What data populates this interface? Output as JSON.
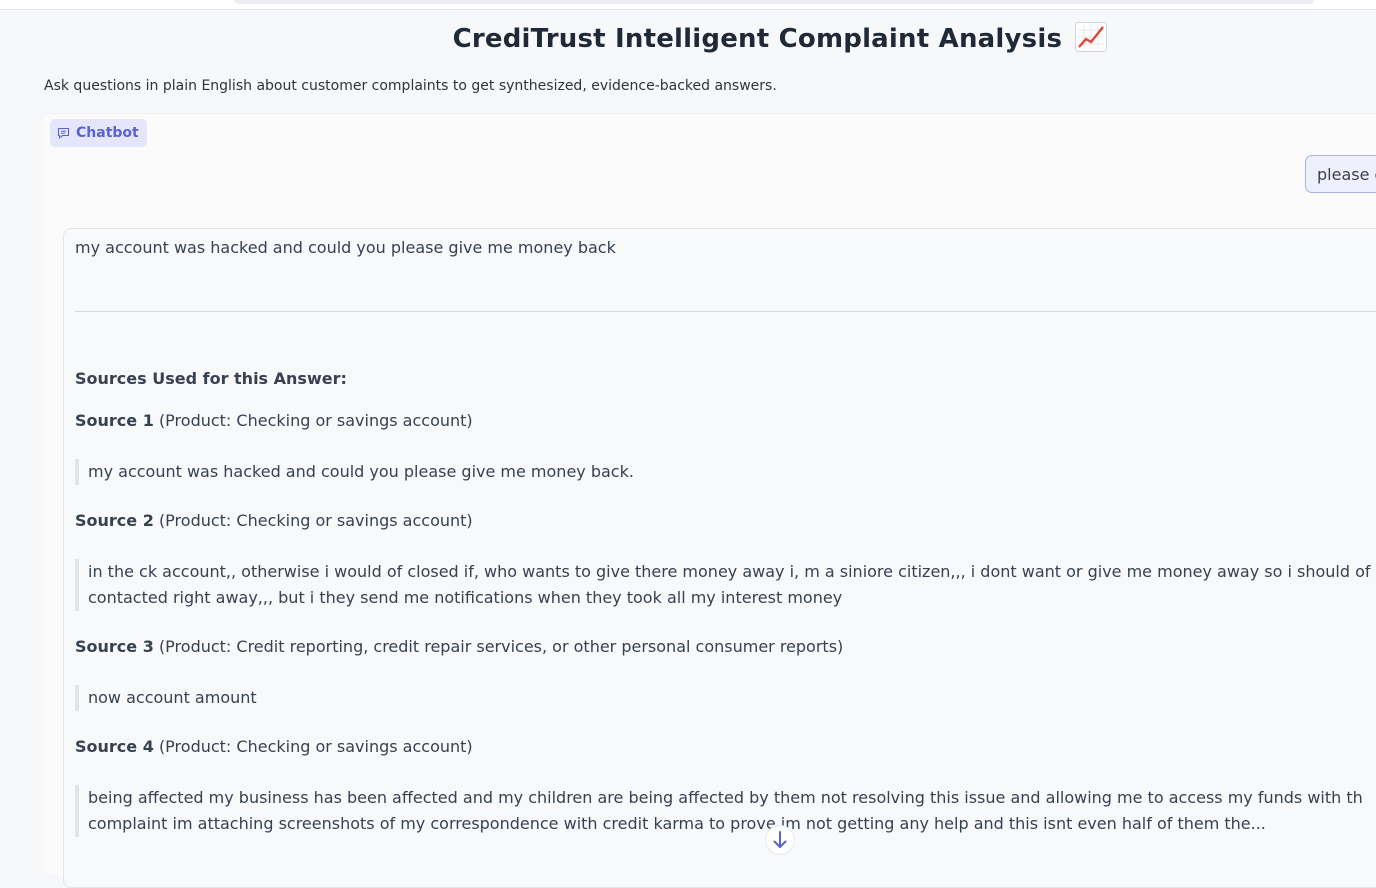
{
  "header": {
    "title": "CrediTrust Intelligent Complaint Analysis",
    "title_icon": "chart-increasing-emoji",
    "subtitle": "Ask questions in plain English about customer complaints to get synthesized, evidence-backed answers."
  },
  "chatbot": {
    "label": "Chatbot",
    "icon": "chat-icon",
    "user_message": "please g",
    "answer": "my account was hacked and could you please give me money back",
    "sources_heading": "Sources Used for this Answer:",
    "sources": [
      {
        "label": "Source 1",
        "product": "(Product: Checking or savings account)",
        "quote_lines": [
          "my account was hacked and could you please give me money back."
        ]
      },
      {
        "label": "Source 2",
        "product": "(Product: Checking or savings account)",
        "quote_lines": [
          "in the ck account,, otherwise i would of closed if, who wants to give there money away i, m a siniore citizen,,, i dont want or give me money away so i should of",
          "contacted right away,,, but i they send me notifications when they took all my interest money"
        ]
      },
      {
        "label": "Source 3",
        "product": "(Product: Credit reporting, credit repair services, or other personal consumer reports)",
        "quote_lines": [
          "now account amount"
        ]
      },
      {
        "label": "Source 4",
        "product": "(Product: Checking or savings account)",
        "quote_lines": [
          "being affected my business has been affected and my children are being affected by them not resolving this issue and allowing me to access my funds with th",
          "complaint im attaching screenshots of my correspondence with credit karma to prove im not getting any help and this isnt even half of them the..."
        ]
      }
    ],
    "scroll_icon": "arrow-down-icon"
  },
  "colors": {
    "accent": "#5b60d6",
    "badge_bg": "#e4e7fb",
    "user_bubble_border": "#a8b0e8"
  }
}
